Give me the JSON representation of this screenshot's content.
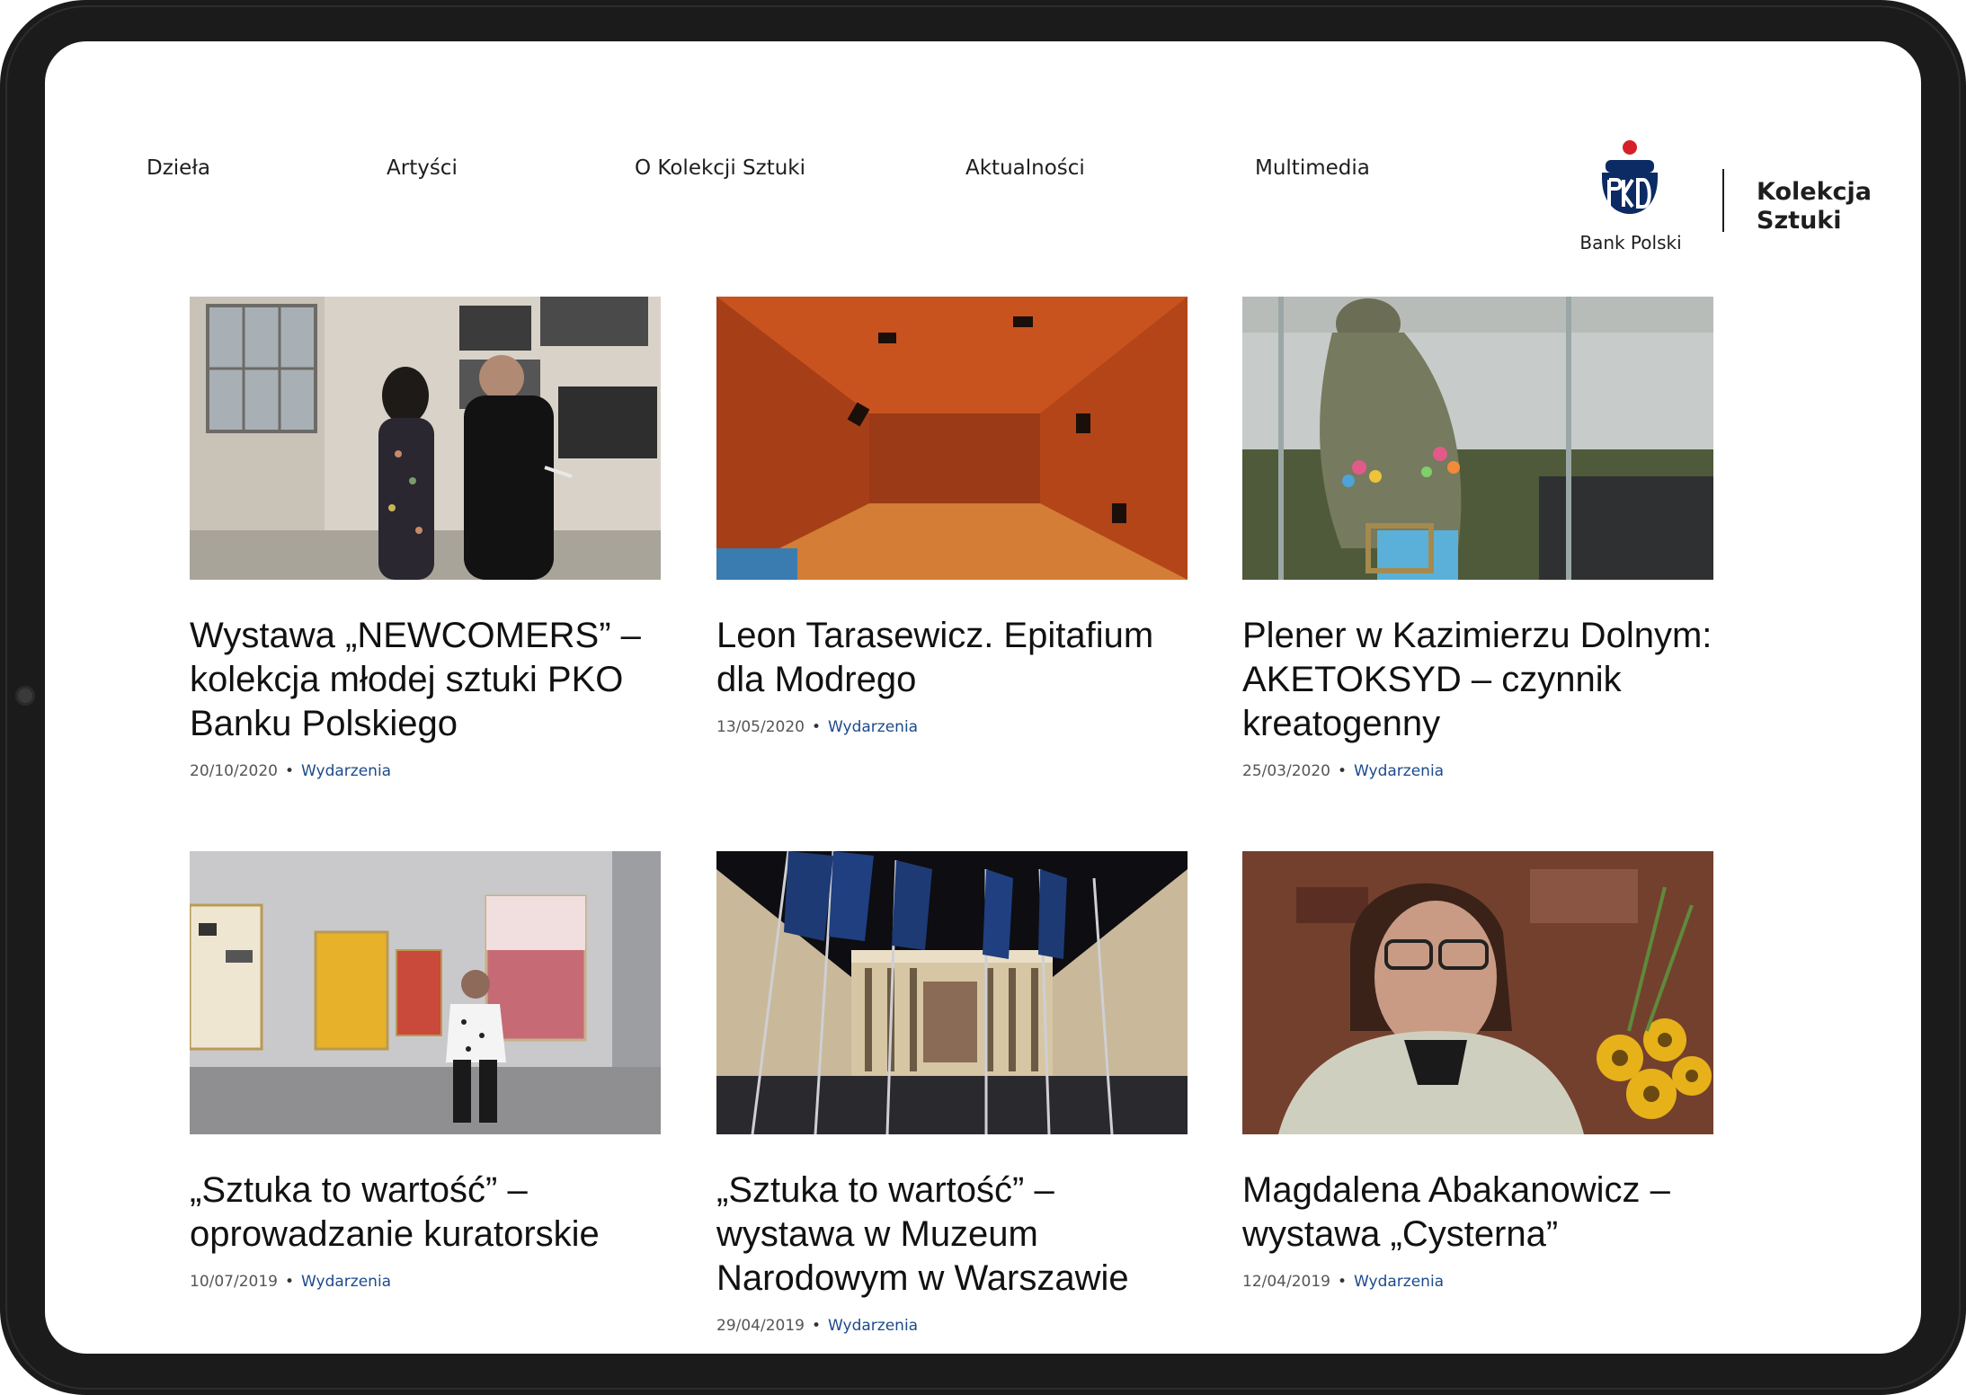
{
  "nav": {
    "items": [
      "Dzieła",
      "Artyści",
      "O Kolekcji Sztuki",
      "Aktualności",
      "Multimedia"
    ]
  },
  "logo": {
    "bank": "Bank Polski",
    "title_line1": "Kolekcja",
    "title_line2": "Sztuki",
    "colors": {
      "navy": "#0c2a63",
      "red": "#d5202a"
    }
  },
  "articles": [
    {
      "title": "Wystawa „NEWCOMERS” – kolekcja młodej sztuki PKO Banku Polskiego",
      "date": "20/10/2020",
      "category": "Wydarzenia"
    },
    {
      "title": "Leon Tarasewicz. Epitafium dla Modrego",
      "date": "13/05/2020",
      "category": "Wydarzenia"
    },
    {
      "title": "Plener w Kazimierzu Dolnym: AKETOKSYD – czynnik kreatogenny",
      "date": "25/03/2020",
      "category": "Wydarzenia"
    },
    {
      "title": "„Sztuka to wartość” – oprowadzanie kuratorskie",
      "date": "10/07/2019",
      "category": "Wydarzenia"
    },
    {
      "title": "„Sztuka to wartość” – wystawa w Muzeum Narodowym w Warszawie",
      "date": "29/04/2019",
      "category": "Wydarzenia"
    },
    {
      "title": "Magdalena Abakanowicz – wystawa „Cysterna”",
      "date": "12/04/2019",
      "category": "Wydarzenia"
    }
  ],
  "meta_separator": "•"
}
